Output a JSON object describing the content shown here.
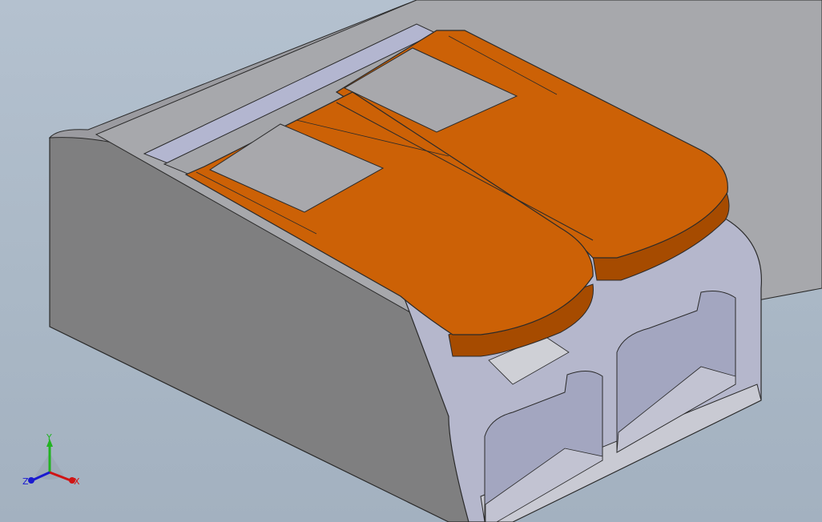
{
  "viewport": {
    "background_top": "#b4c1cf",
    "background_bottom": "#a3b1c0"
  },
  "model": {
    "description_icon": "3d-connector-model",
    "colors": {
      "housing_side": "#7f7f80",
      "housing_top": "#a9a9ad",
      "housing_rim": "#c9cad3",
      "housing_face": "#b5b7cc",
      "cavity": "#a3a6c0",
      "lever_top": "#cc6106",
      "lever_edge": "#d9780f",
      "lever_shadow": "#a64b00"
    }
  },
  "triad": {
    "y_label": "Y",
    "x_label": "X",
    "z_label": "Z",
    "colors": {
      "x": "#d01414",
      "y": "#22b322",
      "z": "#1a1ad0"
    }
  }
}
